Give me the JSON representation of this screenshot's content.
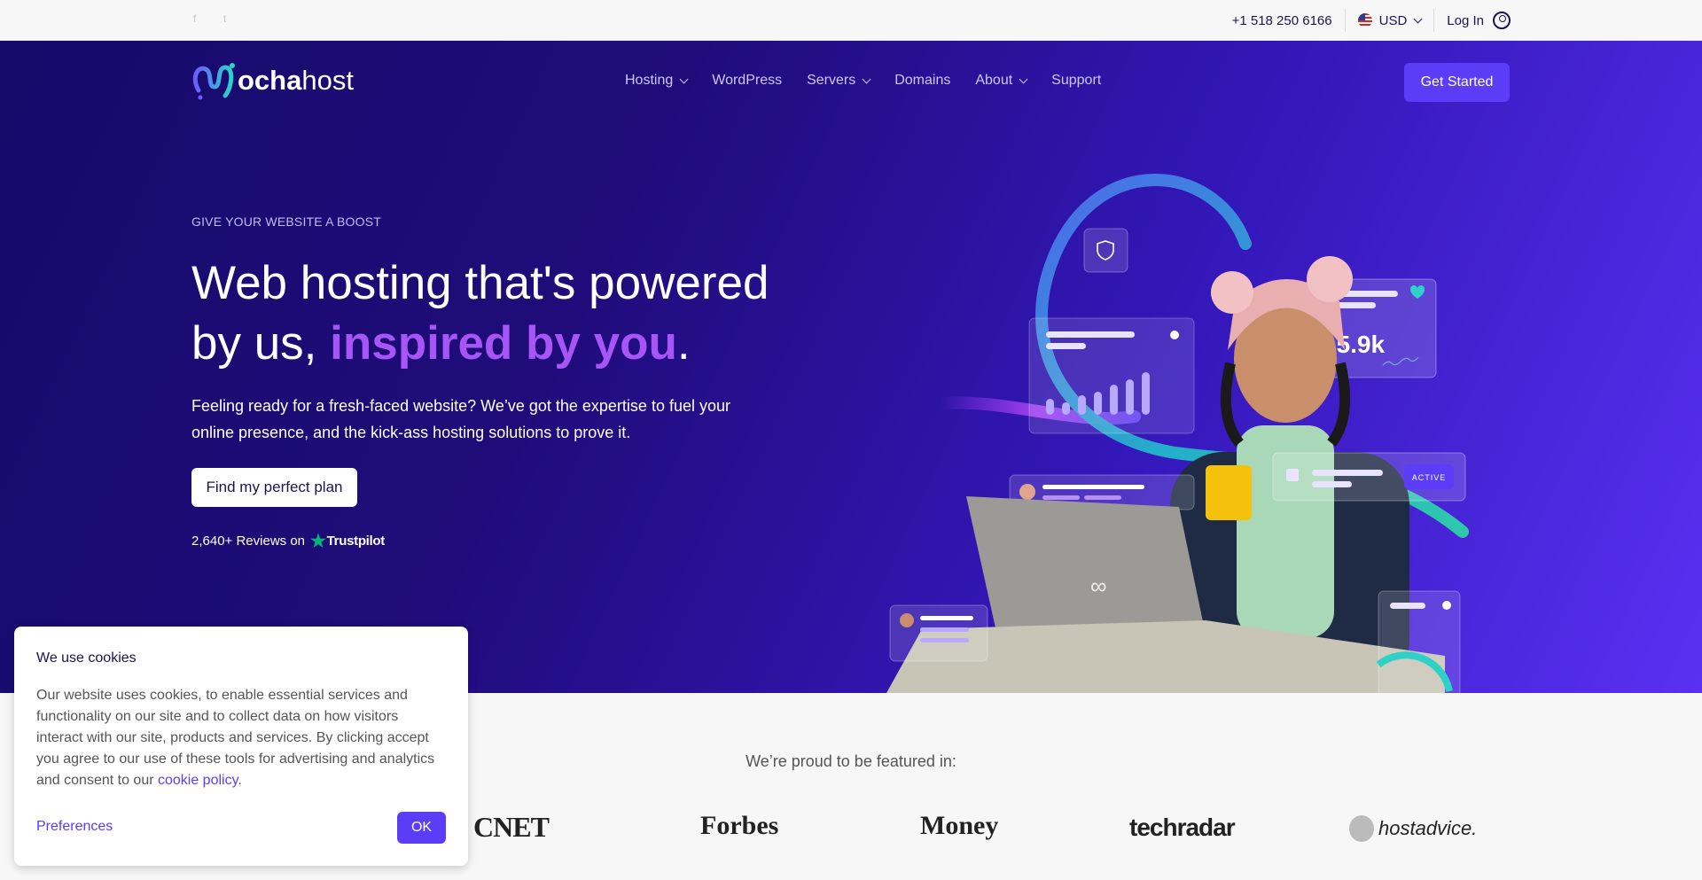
{
  "topbar": {
    "social": [
      {
        "icon": "facebook-icon",
        "label": "f"
      },
      {
        "icon": "twitter-icon",
        "label": "t"
      }
    ],
    "phone": "+1 518 250 6166",
    "currency": "USD",
    "login": "Log In"
  },
  "header": {
    "logo_bold": "ocha",
    "logo_light": "host",
    "logo_text": "Mochahost",
    "nav": [
      {
        "label": "Hosting",
        "dropdown": true
      },
      {
        "label": "WordPress",
        "dropdown": false
      },
      {
        "label": "Servers",
        "dropdown": true
      },
      {
        "label": "Domains",
        "dropdown": false
      },
      {
        "label": "About",
        "dropdown": true
      },
      {
        "label": "Support",
        "dropdown": false
      }
    ],
    "cta": "Get Started"
  },
  "hero": {
    "eyebrow": "GIVE YOUR WEBSITE A BOOST",
    "title_line1": "Web hosting that's powered",
    "title_pre": "by us, ",
    "title_accent": "inspired by you",
    "title_end": ".",
    "lead": "Feeling ready for a fresh-faced website? We’ve got the expertise to fuel your online presence, and the kick-ass hosting solutions to prove it.",
    "cta": "Find my perfect plan",
    "reviews": "2,640+ Reviews on",
    "trustpilot": "Trustpilot",
    "art": {
      "stat": "15.9k",
      "status": "ACTIVE"
    }
  },
  "featured": {
    "heading": "We’re proud to be featured in:",
    "logos": [
      "CNET",
      "Forbes",
      "Money",
      "techradar",
      "hostadvice."
    ]
  },
  "cookie": {
    "title": "We use cookies",
    "body": "Our website uses cookies, to enable essential services and functionality on our site and to collect data on how visitors interact with our site, products and services. By clicking accept you agree to our use of these tools for advertising and analytics and consent to our ",
    "link": "cookie policy",
    "body_end": ".",
    "preferences": "Preferences",
    "ok": "OK"
  },
  "colors": {
    "accent": "#5b3cf7",
    "headline_accent": "#a855f7",
    "hero_dark": "#170a6a",
    "hero_light": "#5a30f2",
    "trustpilot": "#00b67a"
  }
}
